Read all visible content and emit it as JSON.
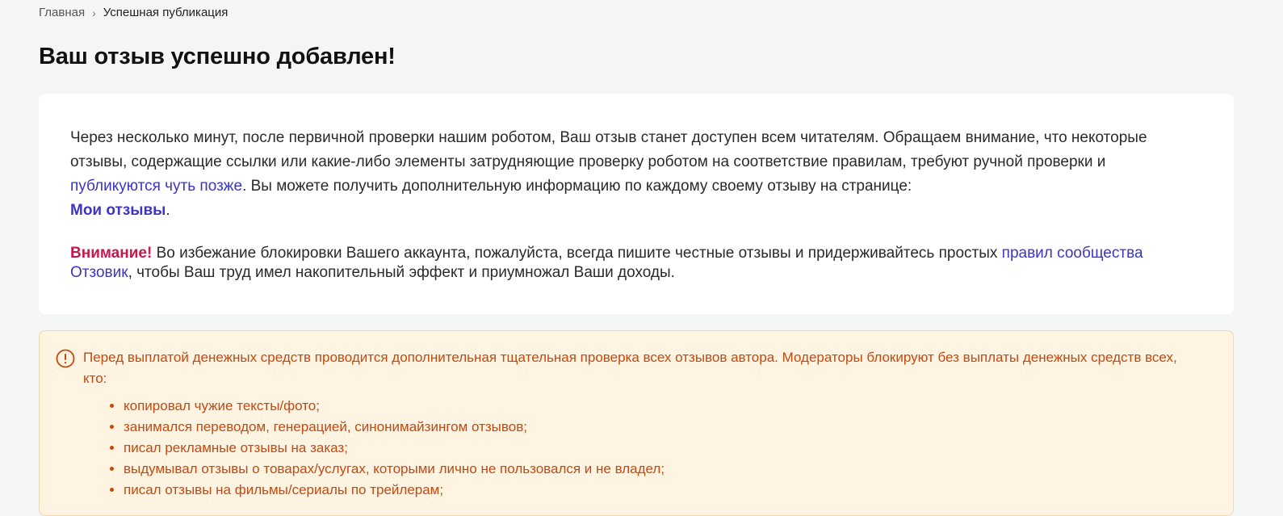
{
  "breadcrumb": {
    "home": "Главная",
    "separator": "›",
    "current": "Успешная публикация"
  },
  "page_title": "Ваш отзыв успешно добавлен!",
  "card": {
    "p1_text_1": "Через несколько минут, после первичной проверки нашим роботом, Ваш отзыв станет доступен всем читателям. Обращаем внимание, что некоторые отзывы, содержащие ссылки или какие-либо элементы затрудняющие проверку роботом на соответствие правилам, требуют ручной проверки и ",
    "p1_link_later": "публикуются чуть позже",
    "p1_text_2": ". Вы можете получить дополнительную информацию по каждому своему отзыву на странице: ",
    "p1_link_my_reviews": "Мои отзывы",
    "p1_text_3": ".",
    "p2_attention": "Внимание!",
    "p2_text_1": " Во избежание блокировки Вашего аккаунта, пожалуйста, всегда пишите честные отзывы и придерживайтесь простых ",
    "p2_link_rules": "правил сообщества Отзовик",
    "p2_text_2": ", чтобы Ваш труд имел накопительный эффект и приумножал Ваши доходы."
  },
  "notice": {
    "icon": "exclamation-circle-icon",
    "text": "Перед выплатой денежных средств проводится дополнительная тщательная проверка всех отзывов автора. Модераторы блокируют без выплаты денежных средств всех, кто:",
    "items": [
      "копировал чужие тексты/фото;",
      "занимался переводом, генерацией, синонимайзингом отзывов;",
      "писал рекламные отзывы на заказ;",
      "выдумывал отзывы о товарах/услугах, которыми лично не пользовался и не владел;",
      "писал отзывы на фильмы/сериалы по трейлерам;"
    ]
  },
  "colors": {
    "page_bg": "#f4f5f5",
    "link": "#3b35c2",
    "attention": "#c8174b",
    "notice_bg": "#fff3e2",
    "notice_text": "#c24a10"
  }
}
